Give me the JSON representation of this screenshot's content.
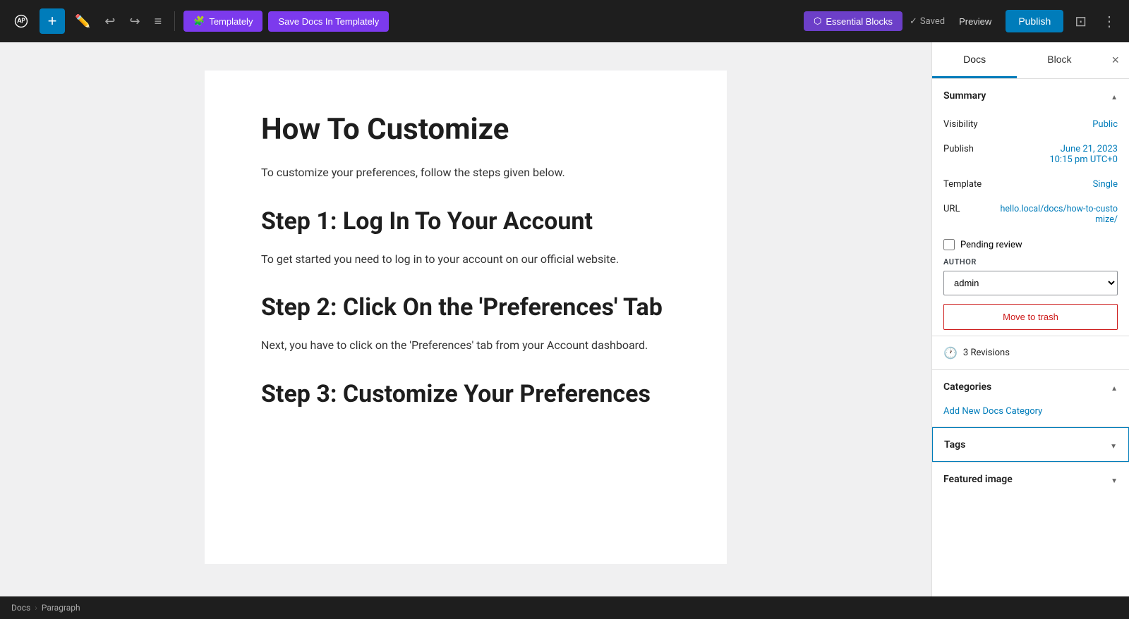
{
  "toolbar": {
    "add_label": "+",
    "undo_label": "↩",
    "redo_label": "↪",
    "list_label": "≡",
    "templately_label": "Templately",
    "save_docs_label": "Save Docs In Templately",
    "essential_blocks_label": "Essential Blocks",
    "saved_label": "Saved",
    "preview_label": "Preview",
    "publish_label": "Publish"
  },
  "editor": {
    "title": "How To Customize",
    "intro": "To customize your preferences, follow the steps given below.",
    "step1_heading": "Step 1: Log In To Your Account",
    "step1_text": "To get started you need to log in to your account on our official website.",
    "step2_heading": "Step 2: Click On the 'Preferences' Tab",
    "step2_text": "Next, you have to click on the 'Preferences' tab from your Account dashboard.",
    "step3_heading": "Step 3: Customize Your Preferences"
  },
  "bottom_bar": {
    "breadcrumb_docs": "Docs",
    "breadcrumb_separator": "›",
    "breadcrumb_paragraph": "Paragraph"
  },
  "sidebar": {
    "tab_docs": "Docs",
    "tab_block": "Block",
    "close_label": "×",
    "summary_title": "Summary",
    "visibility_label": "Visibility",
    "visibility_value": "Public",
    "publish_label": "Publish",
    "publish_value_line1": "June 21, 2023",
    "publish_value_line2": "10:15 pm UTC+0",
    "template_label": "Template",
    "template_value": "Single",
    "url_label": "URL",
    "url_value": "hello.local/docs/how-to-customize/",
    "pending_review_label": "Pending review",
    "author_label": "AUTHOR",
    "author_value": "admin",
    "move_trash_label": "Move to trash",
    "revisions_label": "3 Revisions",
    "categories_title": "Categories",
    "add_category_label": "Add New Docs Category",
    "tags_title": "Tags",
    "featured_title": "Featured image"
  }
}
